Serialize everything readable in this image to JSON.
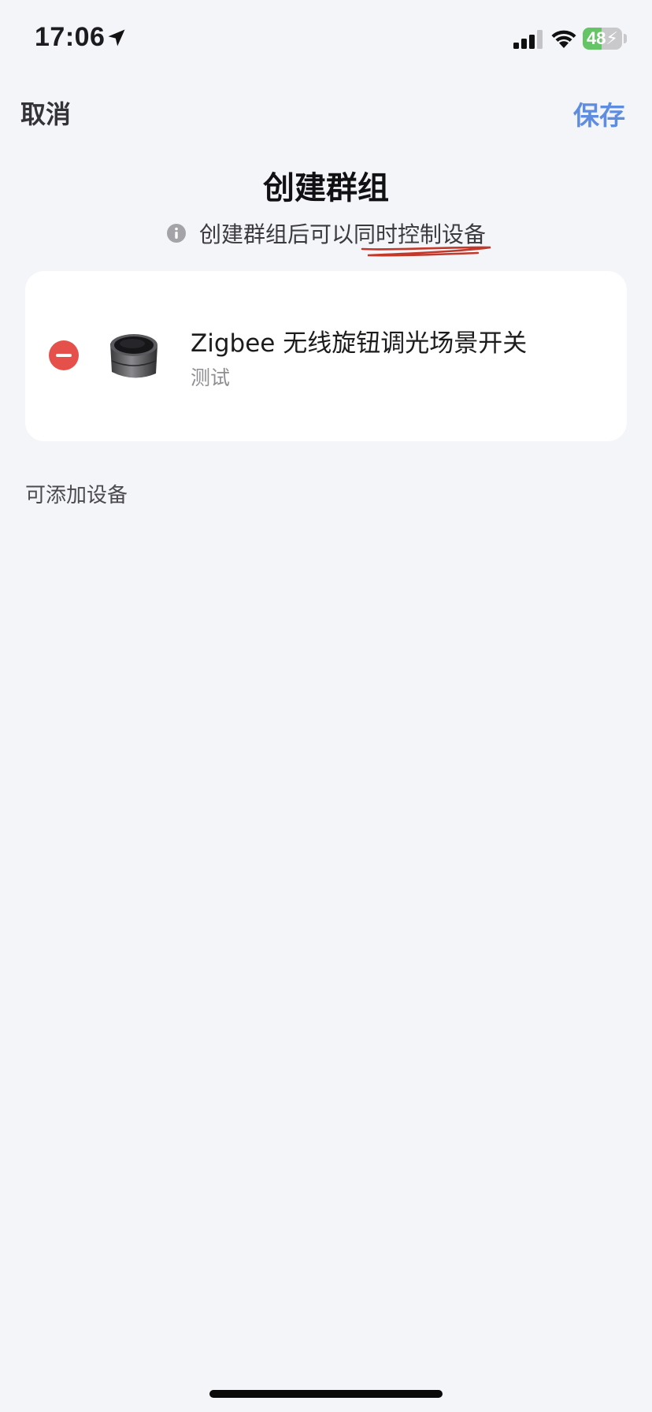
{
  "status_bar": {
    "time": "17:06",
    "battery_level": "48",
    "battery_fraction": 0.48,
    "icons": [
      "location-arrow-icon",
      "signal-bars-icon",
      "wifi-icon",
      "battery-charging-icon"
    ]
  },
  "nav": {
    "cancel_label": "取消",
    "save_label": "保存"
  },
  "page": {
    "title": "创建群组",
    "hint_prefix": "创建群组后可以",
    "hint_emphasis": "同时控制设备"
  },
  "selected_devices": [
    {
      "name": "Zigbee 无线旋钮调光场景开关",
      "room": "测试"
    }
  ],
  "available_section": {
    "label": "可添加设备"
  },
  "colors": {
    "accent": "#5e8de0",
    "remove": "#e5504a",
    "annotation": "#c0392b",
    "background": "#f4f5f9",
    "battery": "#65c466"
  }
}
